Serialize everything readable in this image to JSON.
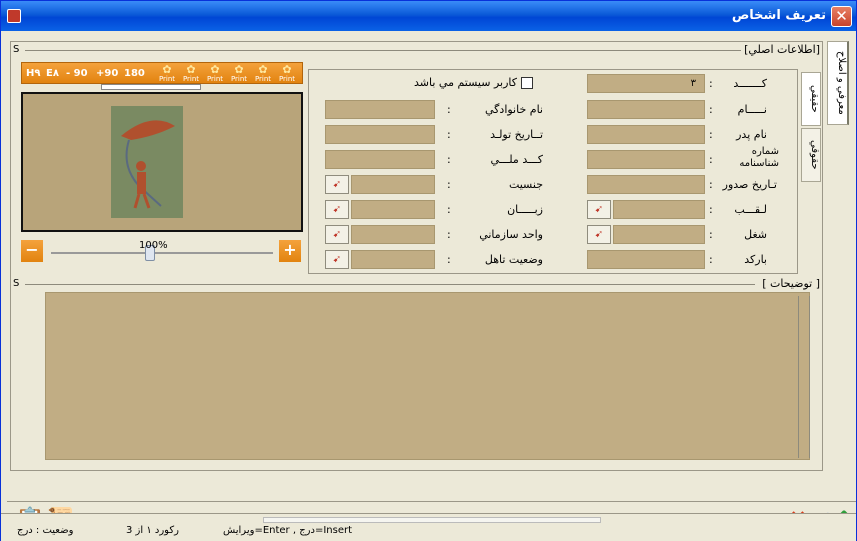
{
  "window": {
    "title": "تعريف اشخاص",
    "close": "✕"
  },
  "tabs": {
    "main": "معرفي و اصلاح",
    "vertical1": "حقيقي",
    "vertical2": "حقوقي"
  },
  "section": {
    "main_header": "[اطلاعات اصلي]",
    "s_marker": "S",
    "desc_header": "[ توضيحات ]",
    "desc_s": "S"
  },
  "toolbar": {
    "h": "H٩",
    "e": "E٨",
    "m90": "- 90",
    "p90": "+90",
    "r180": "180",
    "print": "Print"
  },
  "zoom": {
    "minus": "−",
    "plus": "+",
    "value": "100%"
  },
  "form": {
    "code_label": "كـــــــد",
    "code_value": "٣",
    "name_label": "نـــــام",
    "father_label": "نام پدر",
    "idno_label": "شماره شناسنامه",
    "issue_label": "تـاريخ صدور",
    "title_label": "لـقـــب",
    "job_label": "شغل",
    "barcode_label": "باركد",
    "sysuser_label": "كاربر سيستم مي باشد",
    "family_label": "نام خانوادگي",
    "birth_label": "تــاريخ تولـد",
    "national_label": "كـــد ملـــي",
    "gender_label": "جنسيت",
    "lang_label": "زبـــــان",
    "org_label": "واحد سازماني",
    "marital_label": "وضعيت تاهل",
    "colon": ":"
  },
  "status": {
    "hint": "Insert=درج , Enter=ويرايش",
    "record": "ركورد ١ از 3",
    "mode": "وضعيت : درج"
  },
  "colors": {
    "field": "#c1ad84",
    "orange": "#e2830f",
    "titlebar": "#0b5ad8"
  }
}
